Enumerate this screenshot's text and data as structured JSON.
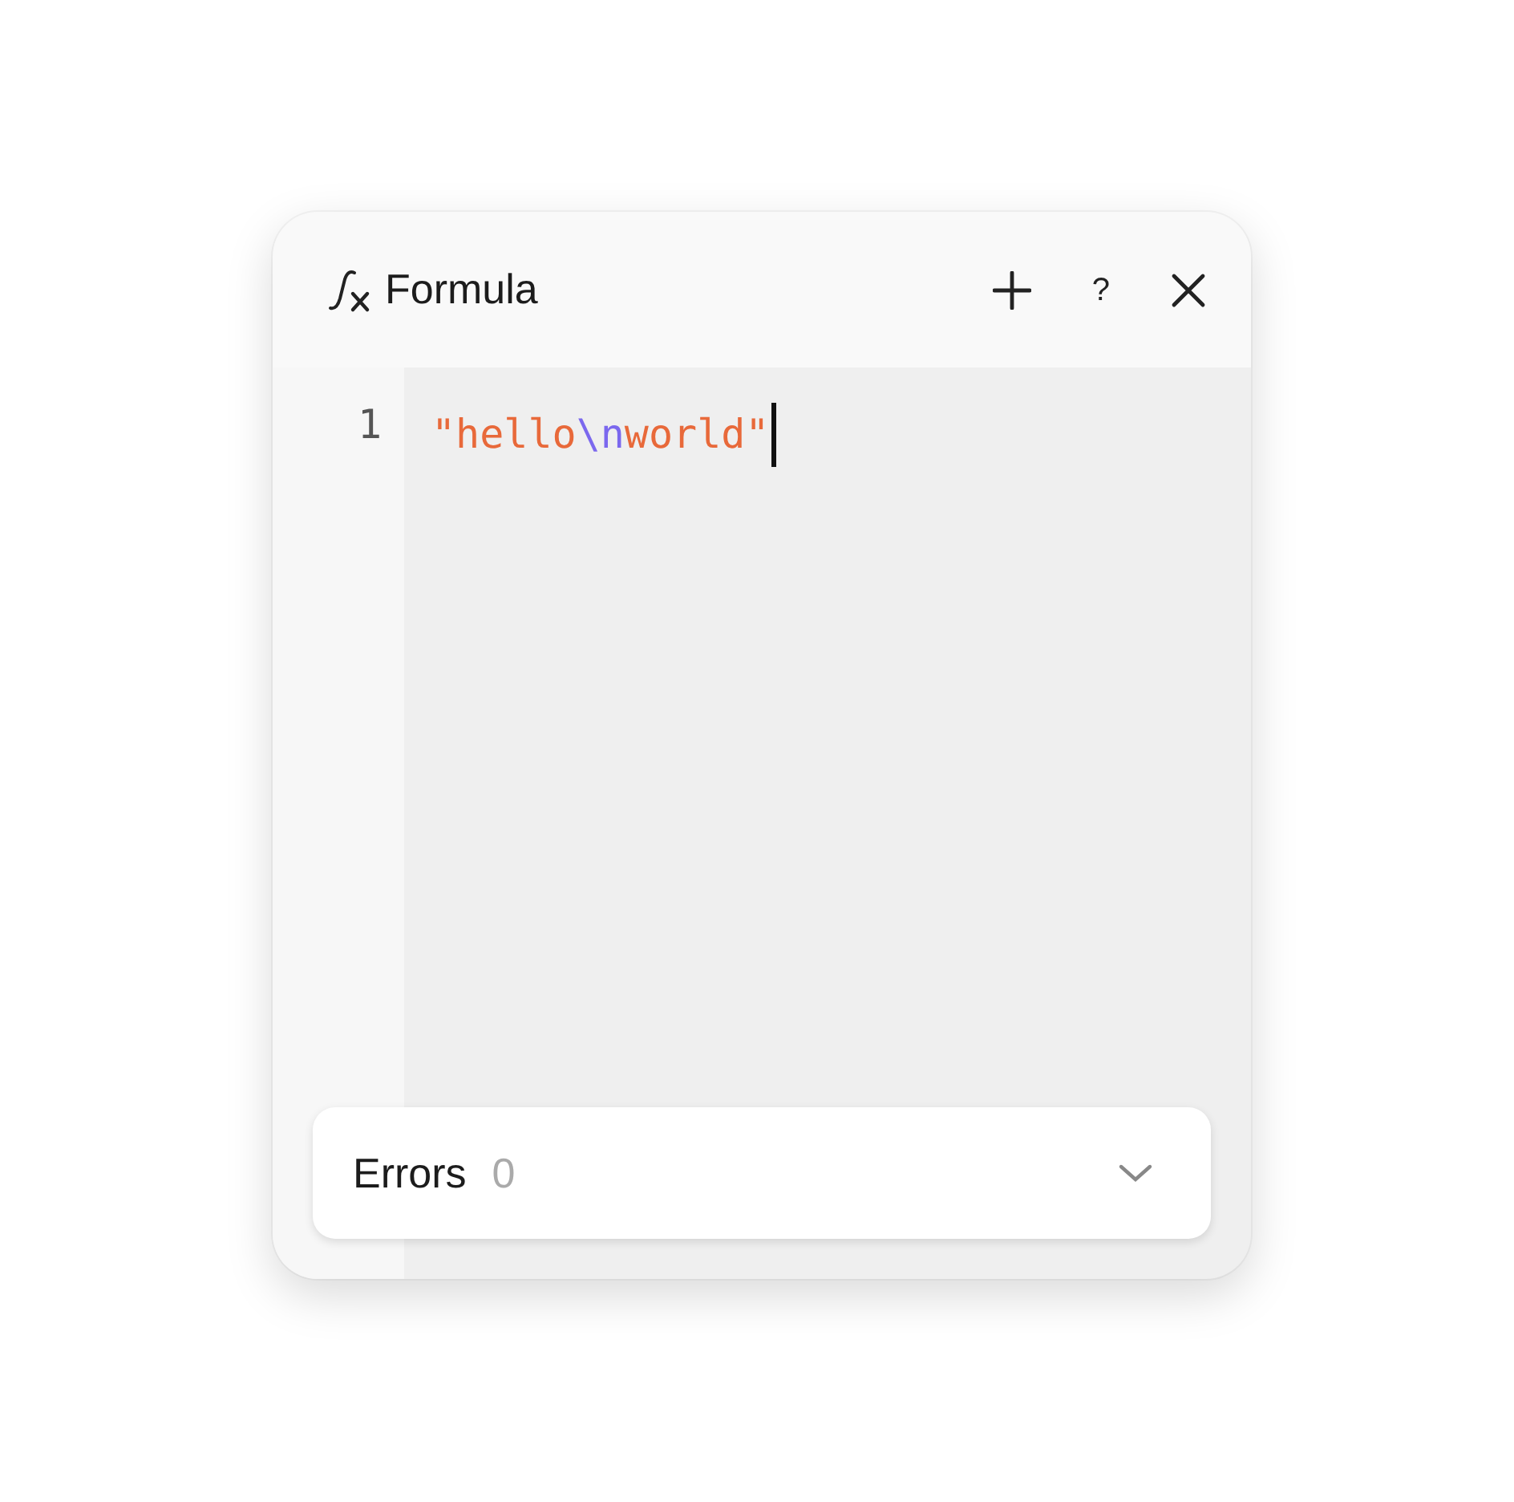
{
  "panel": {
    "title": "Formula",
    "help": "?"
  },
  "editor": {
    "lines": [
      {
        "number": "1",
        "tokens": [
          {
            "kind": "string",
            "text": "\"hello"
          },
          {
            "kind": "escape",
            "text": "\\n"
          },
          {
            "kind": "string",
            "text": "world\""
          }
        ]
      }
    ]
  },
  "errors": {
    "label": "Errors",
    "count": "0",
    "expanded": false
  }
}
